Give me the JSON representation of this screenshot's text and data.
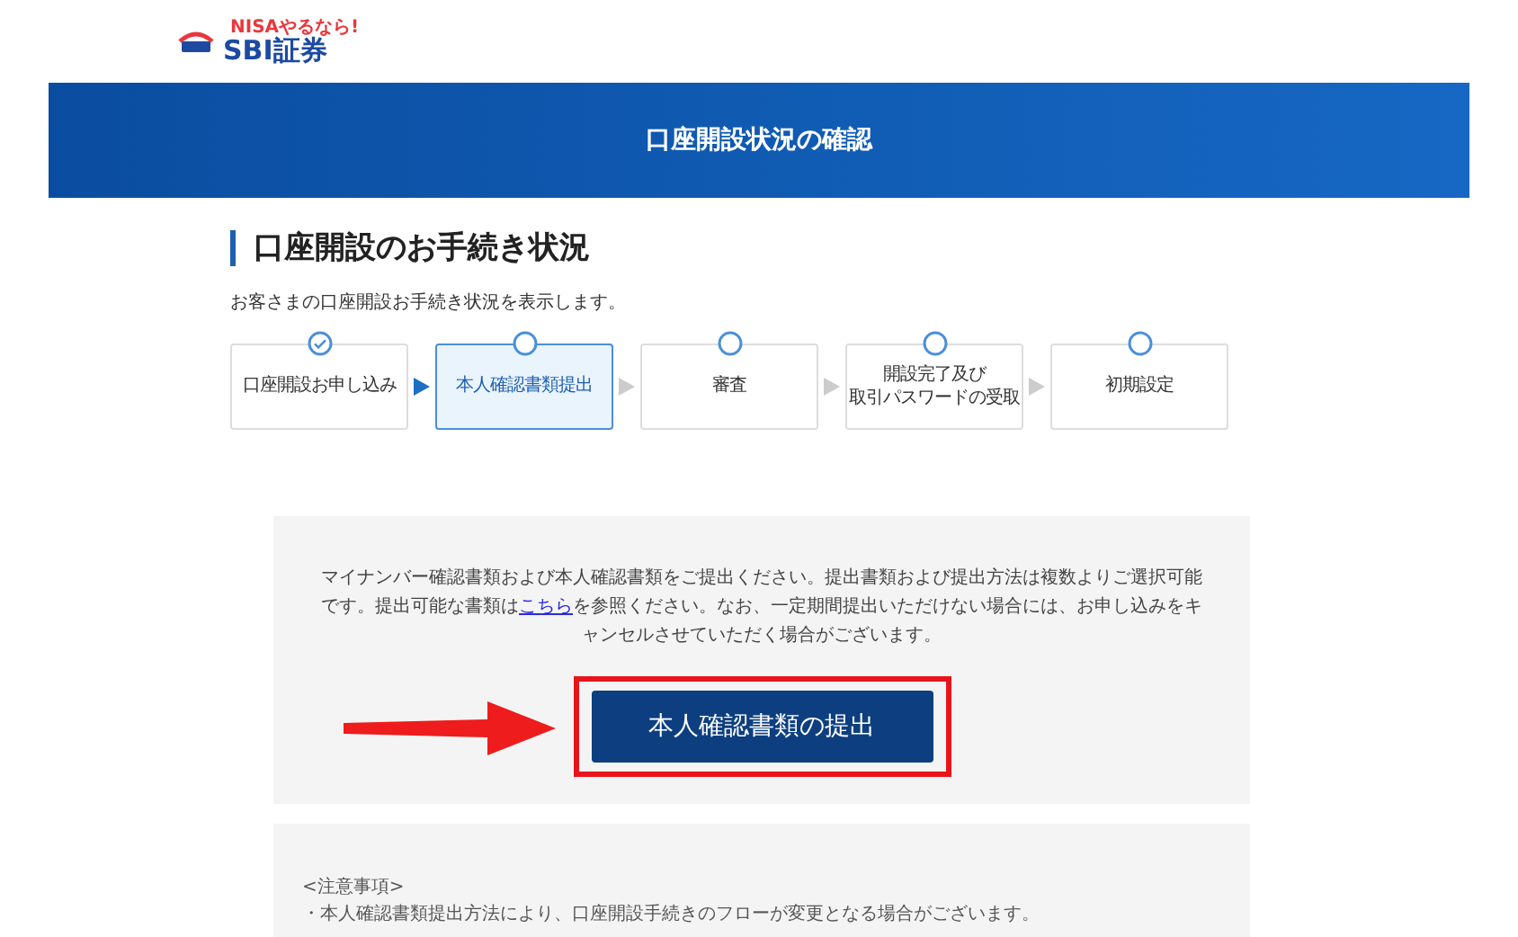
{
  "logo": {
    "tagline": "NISAやるなら!",
    "name": "SBI証券"
  },
  "banner": {
    "title": "口座開設状況の確認"
  },
  "heading": "口座開設のお手続き状況",
  "description": "お客さまの口座開設お手続き状況を表示します。",
  "steps": [
    {
      "lines": [
        "口座開設お申し込み"
      ],
      "done": true,
      "selected": false
    },
    {
      "lines": [
        "本人確認書類提出"
      ],
      "done": false,
      "selected": true
    },
    {
      "lines": [
        "審査"
      ],
      "done": false,
      "selected": false
    },
    {
      "lines": [
        "開設完了及び",
        "取引パスワードの受取"
      ],
      "done": false,
      "selected": false
    },
    {
      "lines": [
        "初期設定"
      ],
      "done": false,
      "selected": false
    }
  ],
  "notice": {
    "before": "マイナンバー確認書類および本人確認書類をご提出ください。提出書類および提出方法は複数よりご選択可能です。提出可能な書類は",
    "link": "こちら",
    "after": "を参照ください。なお、一定期間提出いただけない場合には、お申し込みをキャンセルさせていただく場合がございます。",
    "button": "本人確認書類の提出"
  },
  "notes": {
    "title": "<注意事項>",
    "items": [
      "・本人確認書類提出方法により、口座開設手続きのフローが変更となる場合がございます。"
    ]
  }
}
